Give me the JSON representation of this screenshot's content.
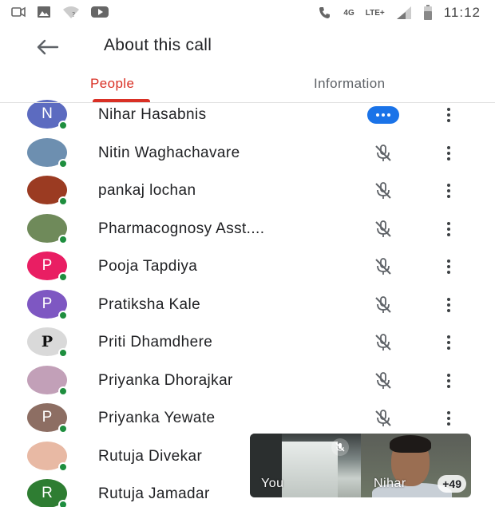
{
  "status_bar": {
    "time": "11:12",
    "network_4g": "4G",
    "network_lte": "LTE+",
    "icons": [
      "video-camera-icon",
      "image-icon",
      "wifi-question-icon",
      "youtube-icon",
      "call-icon",
      "signal-icon",
      "battery-icon"
    ]
  },
  "header": {
    "title": "About this call",
    "back_icon": "arrow-left-icon"
  },
  "tabs": [
    {
      "label": "People",
      "active": true
    },
    {
      "label": "Information",
      "active": false
    }
  ],
  "colors": {
    "accent": "#d93025",
    "online": "#1e8e3e",
    "speaking": "#1a73e8"
  },
  "participants": [
    {
      "name": "Nihar Hasabnis",
      "avatar_letter": "N",
      "avatar_color": "#5c6bc0",
      "status": "speaking"
    },
    {
      "name": "Nitin Waghachavare",
      "avatar_letter": "",
      "avatar_color": "#6d8fb0",
      "status": "muted"
    },
    {
      "name": "pankaj lochan",
      "avatar_letter": "",
      "avatar_color": "#9b3b22",
      "status": "muted"
    },
    {
      "name": "Pharmacognosy Asst....",
      "avatar_letter": "",
      "avatar_color": "#6f8a5a",
      "status": "muted"
    },
    {
      "name": "Pooja Tapdiya",
      "avatar_letter": "P",
      "avatar_color": "#e91e63",
      "status": "muted"
    },
    {
      "name": "Pratiksha Kale",
      "avatar_letter": "P",
      "avatar_color": "#7e57c2",
      "status": "muted"
    },
    {
      "name": "Priti Dhamdhere",
      "avatar_letter": "P",
      "avatar_color": "#d9d9d9",
      "status": "muted"
    },
    {
      "name": "Priyanka Dhorajkar",
      "avatar_letter": "",
      "avatar_color": "#c2a0b8",
      "status": "muted"
    },
    {
      "name": "Priyanka Yewate",
      "avatar_letter": "P",
      "avatar_color": "#8d6e63",
      "status": "muted"
    },
    {
      "name": "Rutuja Divekar",
      "avatar_letter": "",
      "avatar_color": "#e8b9a4",
      "status": "hidden"
    },
    {
      "name": "Rutuja Jamadar",
      "avatar_letter": "R",
      "avatar_color": "#2e7d32",
      "status": "hidden"
    }
  ],
  "pip": {
    "self_label": "You",
    "remote_label": "Nihar",
    "more_count": "+49"
  }
}
